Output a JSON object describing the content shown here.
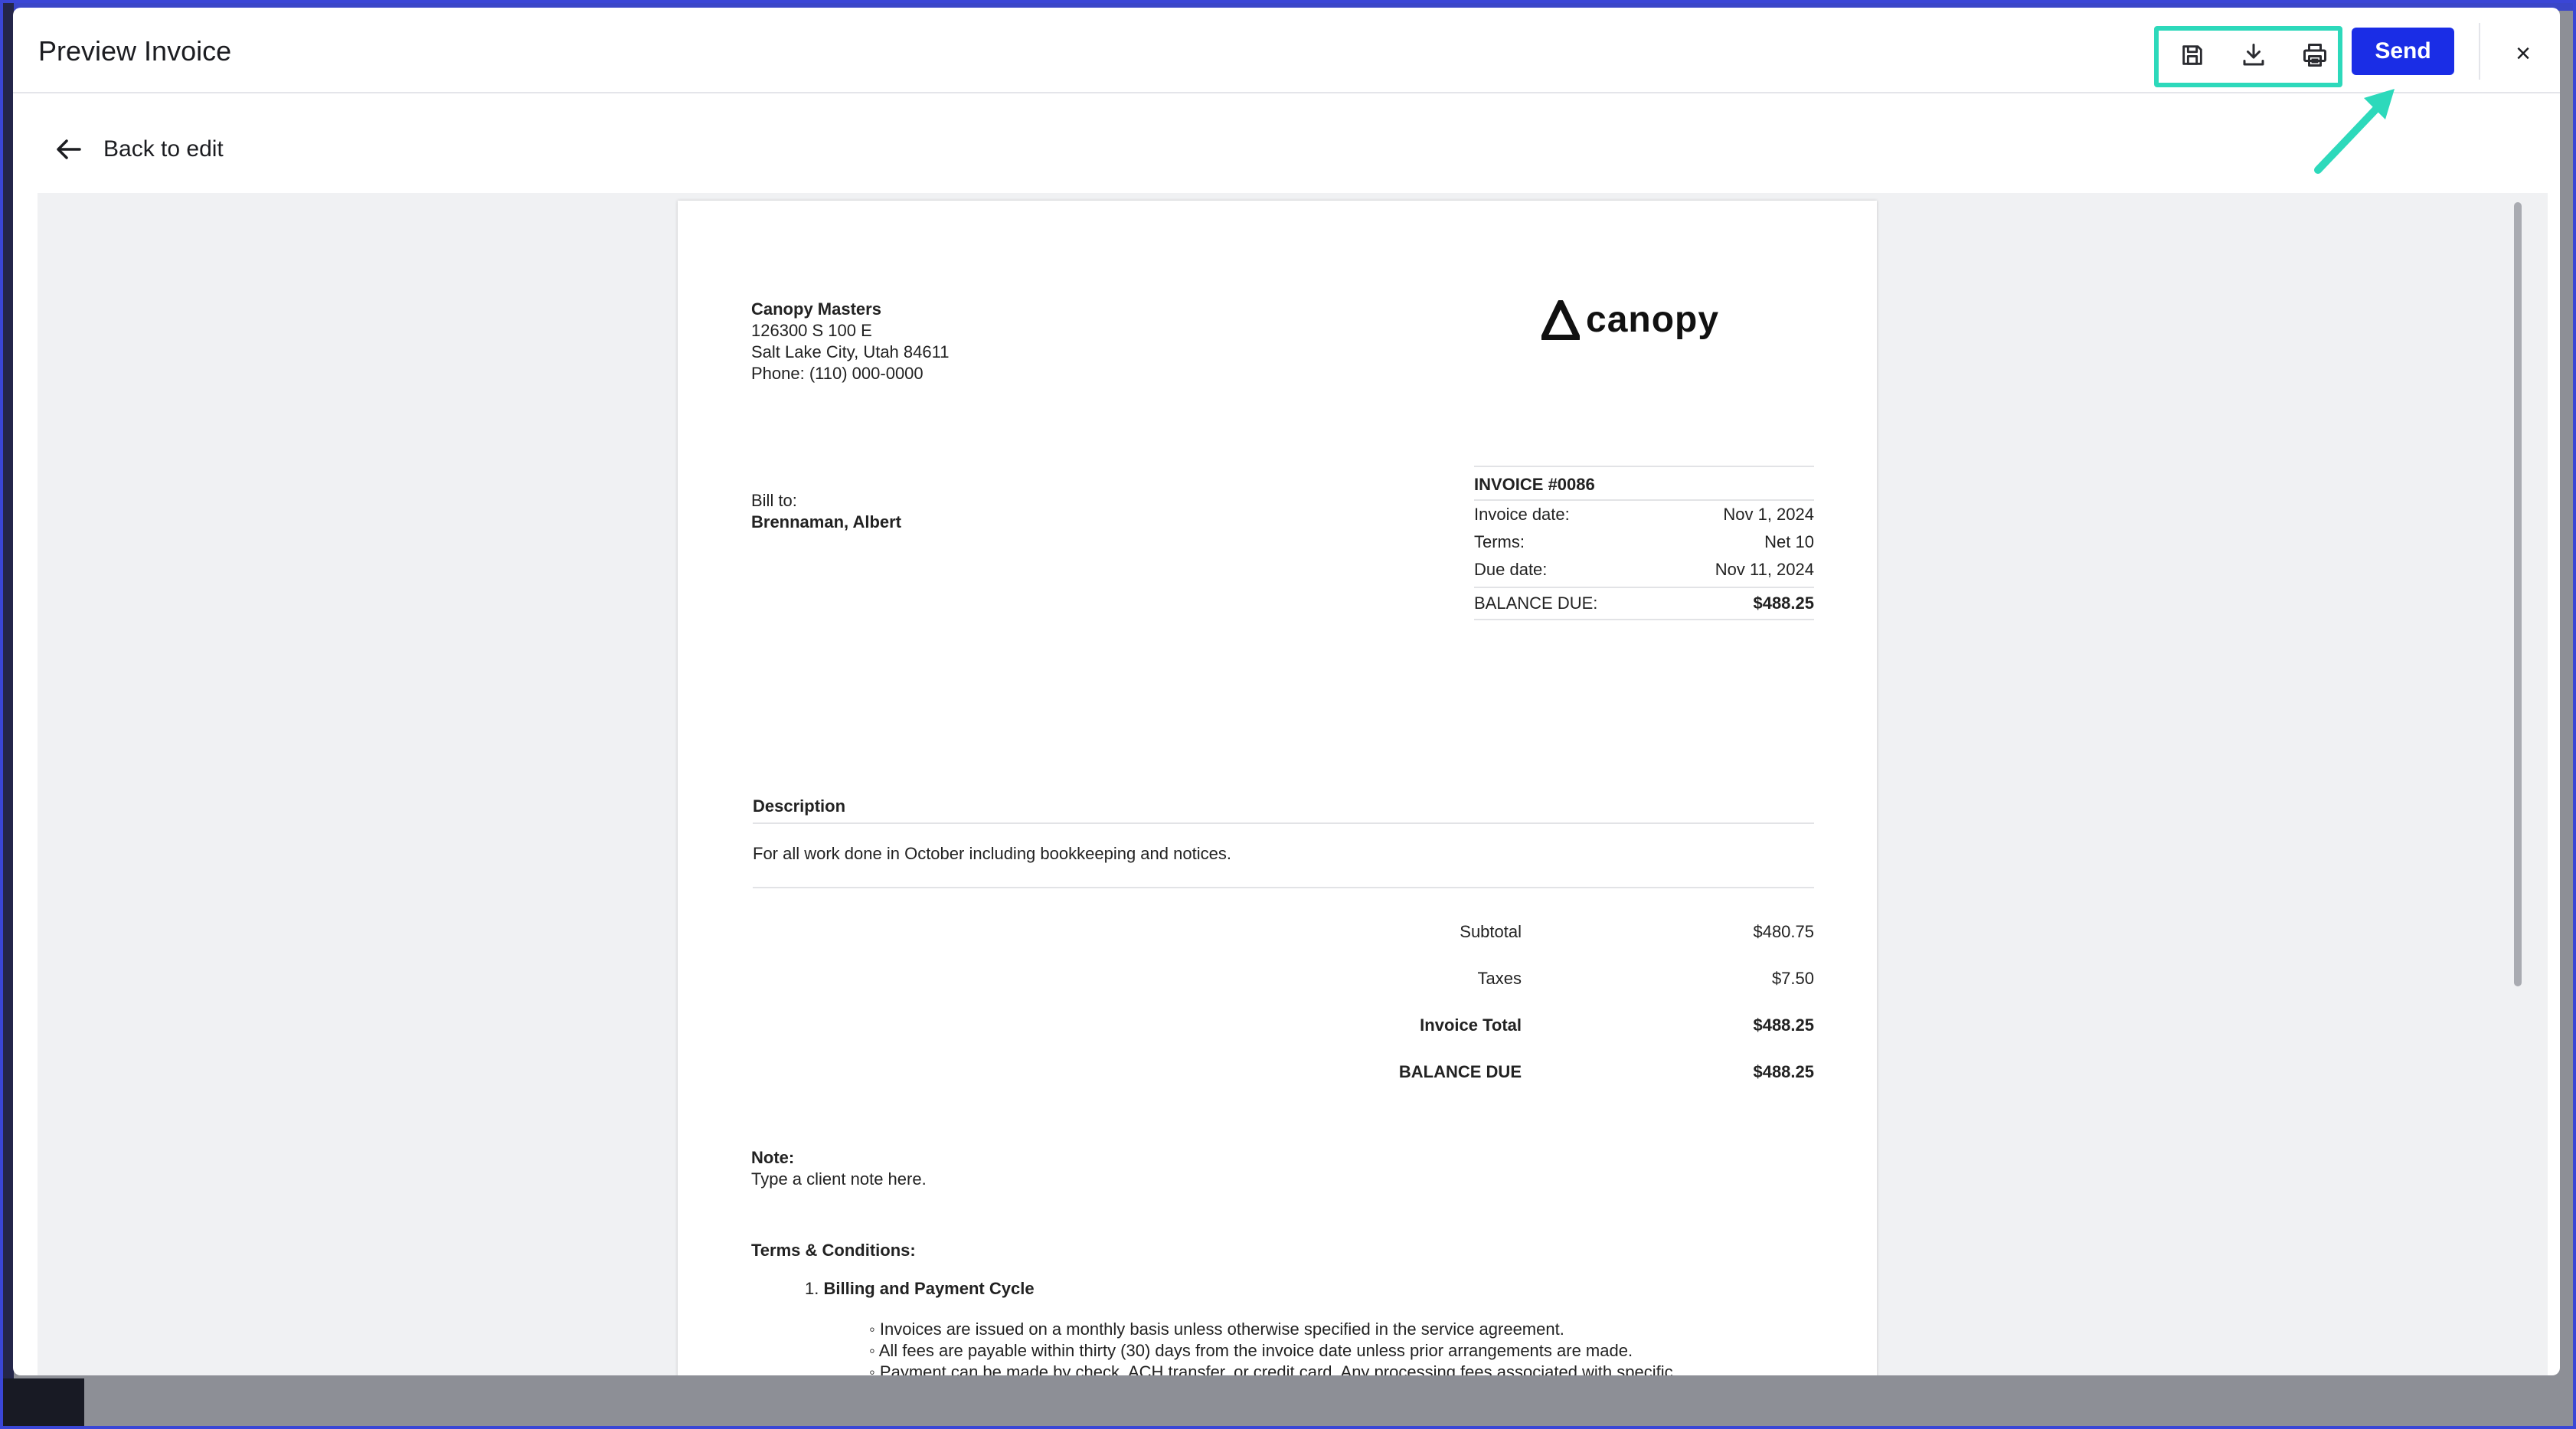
{
  "modal": {
    "title": "Preview Invoice",
    "send_label": "Send",
    "close_label": "×",
    "back_label": "Back to edit",
    "colors": {
      "primary": "#1a2de6",
      "highlight": "#2dd9bb"
    }
  },
  "toolbar": {
    "icons": [
      "save-icon",
      "download-icon",
      "print-icon"
    ]
  },
  "invoice": {
    "company": {
      "name": "Canopy Masters",
      "address1": "126300 S 100 E",
      "address2": "Salt Lake City, Utah 84611",
      "phone": "Phone: (110) 000-0000"
    },
    "logo_text": "canopy",
    "bill_to_label": "Bill to:",
    "client": "Brennaman, Albert",
    "number": "INVOICE #0086",
    "details": [
      {
        "label": "Invoice date:",
        "value": "Nov 1, 2024"
      },
      {
        "label": "Terms:",
        "value": "Net 10"
      },
      {
        "label": "Due date:",
        "value": "Nov 11, 2024"
      }
    ],
    "balance_due_label": "BALANCE DUE:",
    "balance_due_value": "$488.25",
    "description_header": "Description",
    "description": "For all work done in October including bookkeeping and notices.",
    "totals": {
      "subtotal_label": "Subtotal",
      "subtotal": "$480.75",
      "taxes_label": "Taxes",
      "taxes": "$7.50",
      "total_label": "Invoice Total",
      "total": "$488.25",
      "balance_label": "BALANCE DUE",
      "balance": "$488.25"
    },
    "note_label": "Note:",
    "note_text": "Type a client note here.",
    "terms_label": "Terms & Conditions:",
    "terms_item_number": "1.",
    "terms_item_title": "Billing and Payment Cycle",
    "terms_bullets": [
      "◦ Invoices are issued on a monthly basis unless otherwise specified in the service agreement.",
      "◦ All fees are payable within thirty (30) days from the invoice date unless prior arrangements are made.",
      "◦ Payment can be made by check, ACH transfer, or credit card. Any processing fees associated with specific"
    ]
  }
}
